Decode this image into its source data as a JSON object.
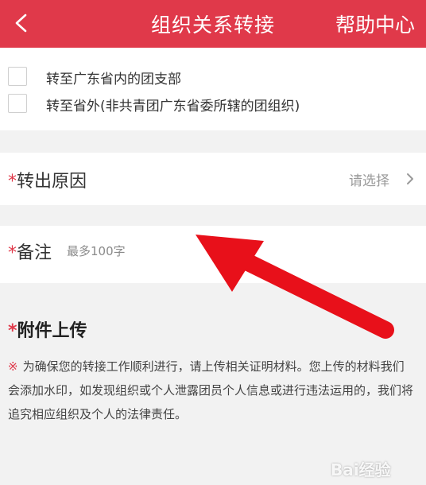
{
  "header": {
    "title": "组织关系转接",
    "help_label": "帮助中心",
    "back_icon": "chevron-left-icon"
  },
  "options": [
    {
      "label": "转至广东省内的团支部"
    },
    {
      "label": "转至省外(非共青团广东省委所辖的团组织)"
    }
  ],
  "reason": {
    "required_mark": "*",
    "label": "转出原因",
    "placeholder": "请选择",
    "chevron_icon": "chevron-right-icon"
  },
  "remark": {
    "required_mark": "*",
    "label": "备注",
    "placeholder": "最多100字",
    "value": ""
  },
  "attachment": {
    "required_mark": "*",
    "title": "附件上传",
    "notice_mark": "※",
    "notice": "为确保您的转接工作顺利进行，请上传相关证明材料。您上传的材料我们会添加水印，如发现组织或个人泄露团员个人信息或进行违法运用的，我们将追究相应组织及个人的法律责任。"
  },
  "watermark": {
    "text": "Bai经验"
  },
  "colors": {
    "header_bg": "#e0394a",
    "required": "#e0394a",
    "arrow": "#e8101a",
    "page_bg": "#f2f2f2"
  }
}
